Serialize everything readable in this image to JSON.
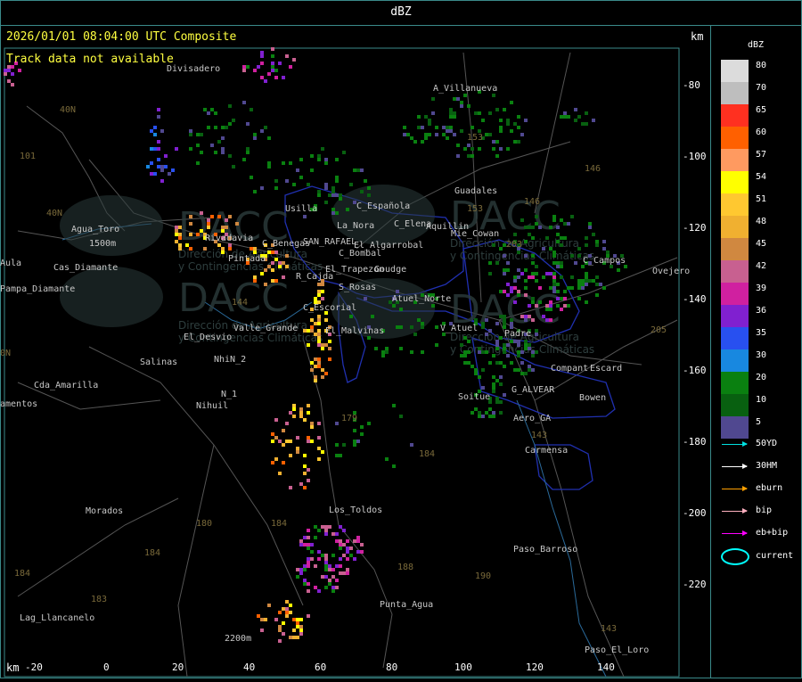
{
  "title": "dBZ",
  "timestamp": "2026/01/01 08:04:00 UTC Composite",
  "track_status": "Track data not available",
  "axis_unit": "km",
  "y_ticks": [
    "-80",
    "-100",
    "-120",
    "-140",
    "-160",
    "-180",
    "-200",
    "-220"
  ],
  "x_ticks": [
    "-20",
    "0",
    "20",
    "40",
    "60",
    "80",
    "100",
    "120",
    "140"
  ],
  "legend": {
    "title": "dBZ",
    "scale": [
      {
        "value": "80",
        "color": "#dcdcdc"
      },
      {
        "value": "70",
        "color": "#bebebe"
      },
      {
        "value": "65",
        "color": "#ff3020"
      },
      {
        "value": "60",
        "color": "#ff6000"
      },
      {
        "value": "57",
        "color": "#ff9a60"
      },
      {
        "value": "54",
        "color": "#ffff00"
      },
      {
        "value": "51",
        "color": "#ffc830"
      },
      {
        "value": "48",
        "color": "#f0b030"
      },
      {
        "value": "45",
        "color": "#d08840"
      },
      {
        "value": "42",
        "color": "#c86090"
      },
      {
        "value": "39",
        "color": "#d020a0"
      },
      {
        "value": "36",
        "color": "#8020d0"
      },
      {
        "value": "35",
        "color": "#2850f0"
      },
      {
        "value": "30",
        "color": "#1888e0"
      },
      {
        "value": "20",
        "color": "#0a8010"
      },
      {
        "value": "10",
        "color": "#086010"
      },
      {
        "value": "5",
        "color": "#504890"
      }
    ],
    "tracks": [
      {
        "label": "50YD",
        "color": "#00e0e0"
      },
      {
        "label": "30HM",
        "color": "#ffffff"
      },
      {
        "label": "eburn",
        "color": "#ffa000"
      },
      {
        "label": "bip",
        "color": "#ffb0c0"
      },
      {
        "label": "eb+bip",
        "color": "#ff00ff"
      }
    ],
    "current_label": "current"
  },
  "places": [
    {
      "name": "Divisadero"
    },
    {
      "name": "A_Villanueva"
    },
    {
      "name": "Guadales"
    },
    {
      "name": "Usilla"
    },
    {
      "name": "C_Española"
    },
    {
      "name": "La_Nora"
    },
    {
      "name": "C_Elena"
    },
    {
      "name": "Aquillin"
    },
    {
      "name": "Agua_Toro"
    },
    {
      "name": "1500m"
    },
    {
      "name": "C_Benegas"
    },
    {
      "name": "SAN_RAFAEL"
    },
    {
      "name": "El_Algarrobal"
    },
    {
      "name": "C_Bombal"
    },
    {
      "name": "Rivadavia"
    },
    {
      "name": "Pintada"
    },
    {
      "name": "El_Trapezon"
    },
    {
      "name": "Goudge"
    },
    {
      "name": "C_Campos"
    },
    {
      "name": "Ovejero"
    },
    {
      "name": "Cas_Diamante"
    },
    {
      "name": "Pampa_Diamante"
    },
    {
      "name": "R_Cajda"
    },
    {
      "name": "S_Rosas"
    },
    {
      "name": "Atuel_Norte"
    },
    {
      "name": "C_Escorial"
    },
    {
      "name": "El_Desvio"
    },
    {
      "name": "Valle_Grande"
    },
    {
      "name": "El_Malvinas"
    },
    {
      "name": "V_Atuel"
    },
    {
      "name": "Padre"
    },
    {
      "name": "Salinas"
    },
    {
      "name": "NhiN_2"
    },
    {
      "name": "Compant"
    },
    {
      "name": "Escard"
    },
    {
      "name": "Cda_Amarilla"
    },
    {
      "name": "N_1"
    },
    {
      "name": "Nihuil"
    },
    {
      "name": "Soitue"
    },
    {
      "name": "G_ALVEAR"
    },
    {
      "name": "Bowen"
    },
    {
      "name": "Aero_GA"
    },
    {
      "name": "Carmensa"
    },
    {
      "name": "Los_Toldos"
    },
    {
      "name": "Morados"
    },
    {
      "name": "Paso_Barroso"
    },
    {
      "name": "Punta_Agua"
    },
    {
      "name": "Lag_Llancanelo"
    },
    {
      "name": "2200m"
    },
    {
      "name": "Paso_El_Loro"
    },
    {
      "name": "Aula"
    },
    {
      "name": "amentos"
    },
    {
      "name": "Mie_Cowan"
    }
  ],
  "watermark": {
    "brand": "DACC",
    "line1": "Dirección de Agricultura",
    "line2": "y Contingencias Climáticas"
  }
}
